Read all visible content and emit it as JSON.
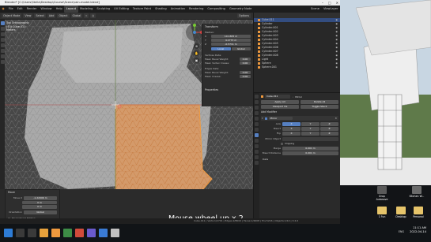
{
  "window": {
    "title": "Blender* [C:\\Users\\Stella\\Desktop\\Course\\Scene\\rain-model.blend]",
    "controls": [
      "–",
      "□",
      "✕"
    ]
  },
  "menu": {
    "items": [
      "File",
      "Edit",
      "Render",
      "Window",
      "Help"
    ],
    "tabs": [
      "Layout",
      "Modeling",
      "Sculpting",
      "UV Editing",
      "Texture Paint",
      "Shading",
      "Animation",
      "Rendering",
      "Compositing",
      "Geometry Node"
    ],
    "active_tab": "Layout",
    "scene": "Scene",
    "view_layer": "ViewLayer"
  },
  "viewport_header": {
    "mode": "Object Mode",
    "view": "View",
    "select": "Select",
    "add": "Add",
    "object": "Object",
    "orientation": "Global",
    "options": "Options"
  },
  "viewport_info": {
    "view": "Top Orthographic",
    "collection": "(43) Cube.011",
    "units": "Meters"
  },
  "npanel": {
    "transform_title": "Transform",
    "median_label": "Median:",
    "median": [
      {
        "axis": "X",
        "value": "10.1305 m"
      },
      {
        "axis": "Y",
        "value": "4.1773 m"
      },
      {
        "axis": "Z",
        "value": "-0.5711 m"
      }
    ],
    "local": "Local",
    "global": "Global",
    "vertices_data": "Vertices Data:",
    "mean_bevel_weight_v": "Mean Bevel Weight:",
    "mean_vertex_crease": "Mean Vertex Crease:",
    "edges_data": "Edges Data:",
    "mean_bevel_weight_e": "Mean Bevel Weight:",
    "mean_crease": "Mean Crease:",
    "zero": "0.00",
    "properties_title": "Properties"
  },
  "outliner": {
    "objects": [
      {
        "name": "Cube.011",
        "selected": true
      },
      {
        "name": "Cylinder",
        "selected": false
      },
      {
        "name": "Cylinder.001",
        "selected": false
      },
      {
        "name": "Cylinder.002",
        "selected": false
      },
      {
        "name": "Cylinder.003",
        "selected": false
      },
      {
        "name": "Cylinder.004",
        "selected": false
      },
      {
        "name": "Cylinder.005",
        "selected": false
      },
      {
        "name": "Cylinder.006",
        "selected": false
      },
      {
        "name": "Cylinder.007",
        "selected": false
      },
      {
        "name": "Cylinder.008",
        "selected": false
      },
      {
        "name": "Light",
        "selected": false
      },
      {
        "name": "Sphere",
        "selected": false
      },
      {
        "name": "Sphere.001",
        "selected": false
      }
    ]
  },
  "properties": {
    "object_name": "Cube.011",
    "modifier_tab": "Mirror",
    "apply": "Apply All",
    "delete": "Delete All",
    "viewport_vis": "Viewport Vis",
    "toggle_stack": "Toggle Stack",
    "add_modifier": "Add Modifier",
    "mirror_name": "Mirror",
    "axis_label": "Axis",
    "bisect_label": "Bisect",
    "flip_label": "Flip",
    "axes": [
      "X",
      "Y",
      "Z"
    ],
    "mirror_object": "Mirror Object",
    "clipping": "Clipping",
    "merge": "Merge",
    "merge_value": "0.001 m",
    "bisect_distance": "Bisect Distance",
    "bisect_value": "0.001 m",
    "data": "Data"
  },
  "operator_panel": {
    "title": "Move",
    "move_label": "Move X",
    "values": [
      "-1.22006 m",
      "0 m",
      "0 m"
    ],
    "orientation_label": "Orientation",
    "orientation": "Global",
    "proportional": "Proportional Editing"
  },
  "status_bar": "Cube.011 | Verts:1/2701 | Edges:2/8002 | Faces:1/2608 | Tris:5216 | Objects:1/14 | 3.2.0",
  "caption": "Mouse wheel up x 2",
  "desktop": {
    "icons": [
      "Drop Autosave",
      "Kitchen W...",
      "1 Fun",
      "Desktop",
      "Personal"
    ]
  },
  "taskbar": {
    "time": "11:11 AM",
    "date": "2022-04-14",
    "lang": "ENG"
  },
  "colors": {
    "accent": "#5680c2",
    "selection": "#f09a3e",
    "mesh_face": "#c6c6c6",
    "mesh_selected": "#d9955a"
  }
}
